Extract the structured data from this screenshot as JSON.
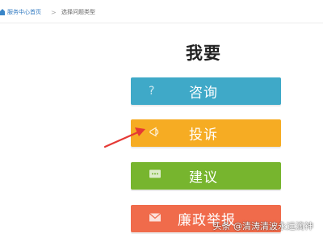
{
  "breadcrumb": {
    "home_link": "服务中心首页",
    "separator": ">",
    "current": "选择问题类型"
  },
  "heading": "我要",
  "options": [
    {
      "label": "咨询",
      "icon": "question-icon",
      "glyph": "?",
      "color": "#3fa9c8"
    },
    {
      "label": "投诉",
      "icon": "megaphone-icon",
      "glyph": "✉",
      "color": "#f6ac23"
    },
    {
      "label": "建议",
      "icon": "chat-bubble-icon",
      "glyph": "…",
      "color": "#77b52e"
    },
    {
      "label": "廉政举报",
      "icon": "envelope-icon",
      "glyph": "✉",
      "color": "#f06b4b"
    }
  ],
  "watermark": "头条 @清涛清波永远滴神",
  "colors": {
    "arrow": "#e53935",
    "link": "#2f78c0"
  }
}
